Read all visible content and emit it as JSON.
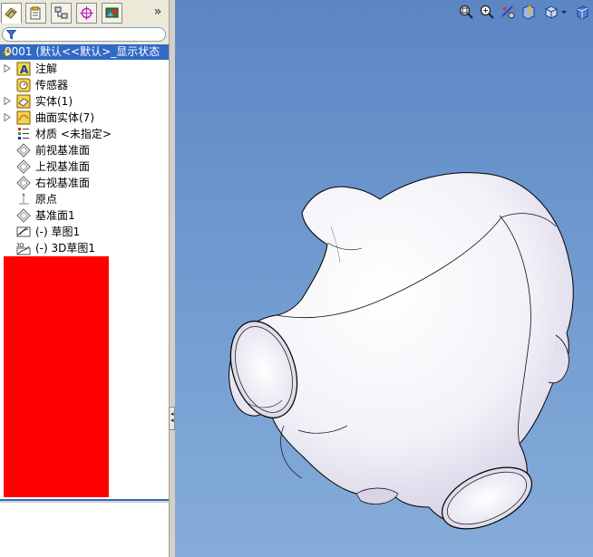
{
  "tree": {
    "root_label": "0001 (默认<<默认>_显示状态",
    "items": [
      {
        "label": "注解",
        "expandable": true
      },
      {
        "label": "传感器",
        "expandable": false
      },
      {
        "label": "实体(1)",
        "expandable": true
      },
      {
        "label": "曲面实体(7)",
        "expandable": true
      },
      {
        "label": "材质 <未指定>",
        "expandable": false
      },
      {
        "label": "前视基准面",
        "expandable": false
      },
      {
        "label": "上视基准面",
        "expandable": false
      },
      {
        "label": "右视基准面",
        "expandable": false
      },
      {
        "label": "原点",
        "expandable": false
      },
      {
        "label": "基准面1",
        "expandable": false
      },
      {
        "label": "(-) 草图1",
        "expandable": false
      },
      {
        "label": "(-) 3D草图1",
        "expandable": false
      }
    ]
  },
  "panel_tabs": [
    "featuremanager-tab",
    "propertymanager-tab",
    "configurationmanager-tab",
    "dimxpert-tab",
    "display-manager-tab"
  ],
  "more_label": "»",
  "colors": {
    "selection": "#316ac5",
    "viewport_top": "#5c86c4",
    "viewport_bottom": "#85acd9",
    "redaction": "#ff0000"
  }
}
